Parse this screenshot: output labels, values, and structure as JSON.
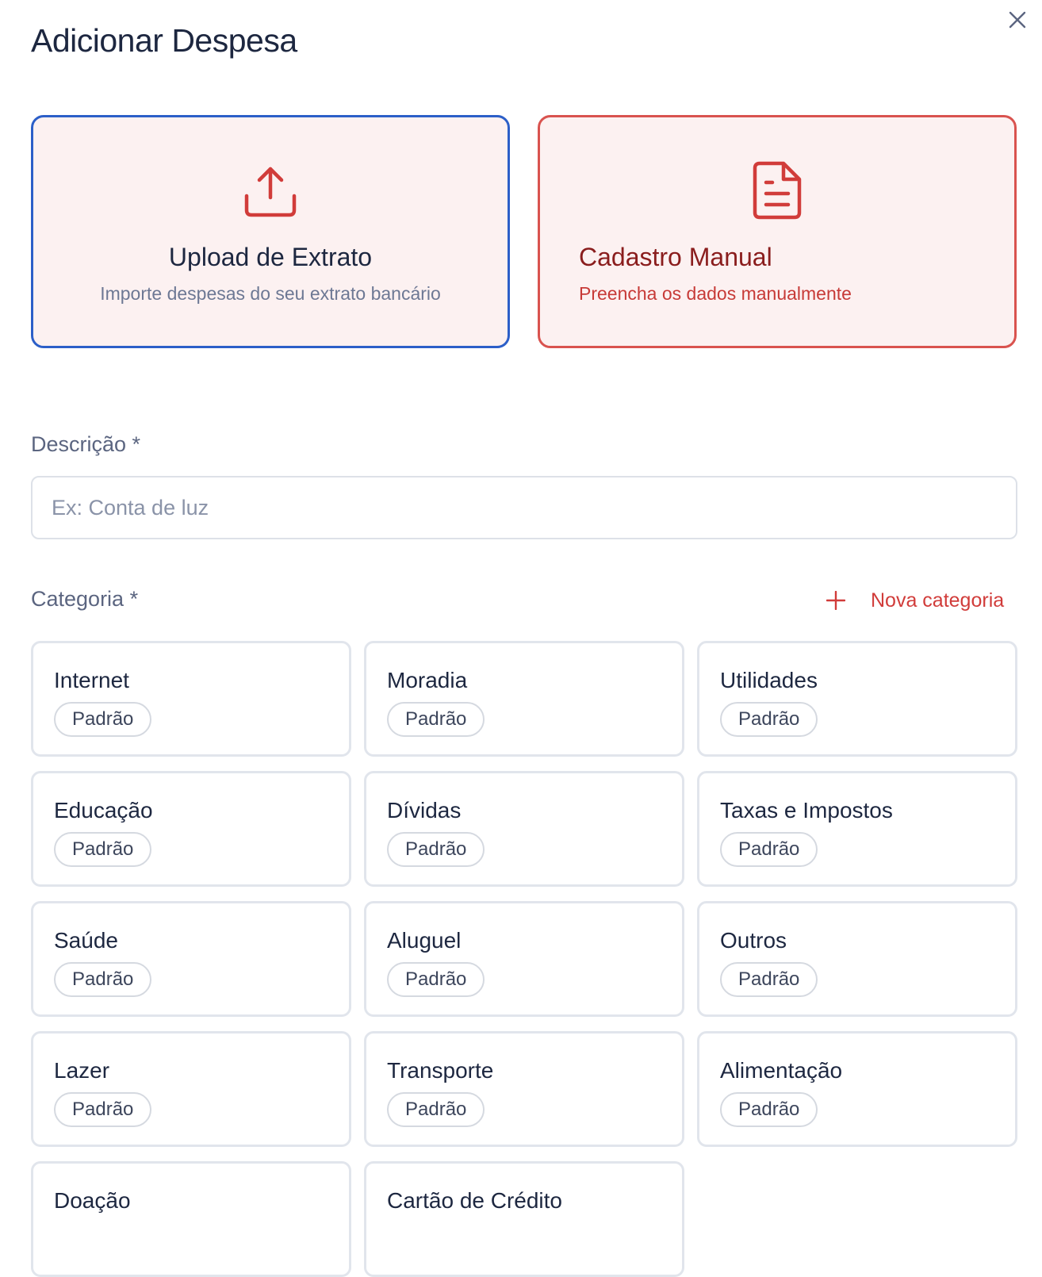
{
  "dialog": {
    "title": "Adicionar Despesa",
    "close_icon": "close-icon"
  },
  "modes": {
    "upload": {
      "title": "Upload de Extrato",
      "subtitle": "Importe despesas do seu extrato bancário",
      "icon": "upload-icon",
      "border_color": "#2c5fc8"
    },
    "manual": {
      "title": "Cadastro Manual",
      "subtitle": "Preencha os dados manualmente",
      "icon": "document-icon",
      "border_color": "#d9534f"
    }
  },
  "description": {
    "label": "Descrição *",
    "placeholder": "Ex: Conta de luz",
    "value": ""
  },
  "category": {
    "label": "Categoria *",
    "new_label": "Nova categoria",
    "items": [
      {
        "name": "Internet",
        "badge": "Padrão"
      },
      {
        "name": "Moradia",
        "badge": "Padrão"
      },
      {
        "name": "Utilidades",
        "badge": "Padrão"
      },
      {
        "name": "Educação",
        "badge": "Padrão"
      },
      {
        "name": "Dívidas",
        "badge": "Padrão"
      },
      {
        "name": "Taxas e Impostos",
        "badge": "Padrão"
      },
      {
        "name": "Saúde",
        "badge": "Padrão"
      },
      {
        "name": "Aluguel",
        "badge": "Padrão"
      },
      {
        "name": "Outros",
        "badge": "Padrão"
      },
      {
        "name": "Lazer",
        "badge": "Padrão"
      },
      {
        "name": "Transporte",
        "badge": "Padrão"
      },
      {
        "name": "Alimentação",
        "badge": "Padrão"
      },
      {
        "name": "Doação",
        "badge": ""
      },
      {
        "name": "Cartão de Crédito",
        "badge": ""
      }
    ]
  },
  "colors": {
    "accent_red": "#d13c3a",
    "accent_blue": "#2c5fc8",
    "text_dark": "#1d2740"
  }
}
